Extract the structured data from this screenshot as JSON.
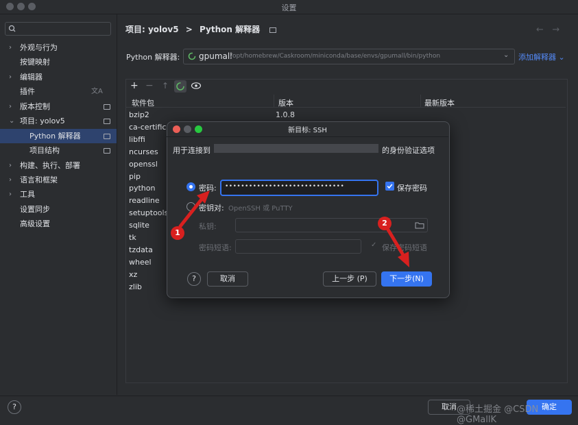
{
  "window": {
    "title": "设置"
  },
  "colors": {
    "accent": "#3574f0",
    "link": "#548af7",
    "annotation": "#d8201f",
    "selection": "#2e436e"
  },
  "sidebar": {
    "items": [
      {
        "label": "外观与行为",
        "chevron": true,
        "badge": false
      },
      {
        "label": "按键映射",
        "chevron": false,
        "badge": false
      },
      {
        "label": "编辑器",
        "chevron": true,
        "badge": false
      },
      {
        "label": "插件",
        "chevron": false,
        "badge": false,
        "icon": "translate-icon"
      },
      {
        "label": "版本控制",
        "chevron": true,
        "badge": true
      },
      {
        "label": "项目: yolov5",
        "chevron": true,
        "expanded": true,
        "badge": true
      },
      {
        "label": "Python 解释器",
        "chevron": false,
        "badge": true,
        "selected": true
      },
      {
        "label": "项目结构",
        "chevron": false,
        "badge": true
      },
      {
        "label": "构建、执行、部署",
        "chevron": true,
        "badge": false
      },
      {
        "label": "语言和框架",
        "chevron": true,
        "badge": false
      },
      {
        "label": "工具",
        "chevron": true,
        "badge": false
      },
      {
        "label": "设置同步",
        "chevron": false,
        "badge": false
      },
      {
        "label": "高级设置",
        "chevron": false,
        "badge": false
      }
    ]
  },
  "header": {
    "project": "项目: yolov5",
    "separator": ">",
    "page": "Python 解释器"
  },
  "interpreter": {
    "label": "Python 解释器:",
    "name": "gpumall",
    "path": "/opt/homebrew/Caskroom/miniconda/base/envs/gpumall/bin/python",
    "add_label": "添加解释器"
  },
  "packages": {
    "columns": [
      "软件包",
      "版本",
      "最新版本"
    ],
    "rows": [
      {
        "name": "bzip2",
        "version": "1.0.8"
      },
      {
        "name": "ca-certific",
        "version": ""
      },
      {
        "name": "libffi",
        "version": ""
      },
      {
        "name": "ncurses",
        "version": ""
      },
      {
        "name": "openssl",
        "version": ""
      },
      {
        "name": "pip",
        "version": ""
      },
      {
        "name": "python",
        "version": ""
      },
      {
        "name": "readline",
        "version": ""
      },
      {
        "name": "setuptools",
        "version": ""
      },
      {
        "name": "sqlite",
        "version": ""
      },
      {
        "name": "tk",
        "version": ""
      },
      {
        "name": "tzdata",
        "version": ""
      },
      {
        "name": "wheel",
        "version": ""
      },
      {
        "name": "xz",
        "version": ""
      },
      {
        "name": "zlib",
        "version": ""
      }
    ]
  },
  "dialog": {
    "title": "新目标: SSH",
    "desc_prefix": "用于连接到",
    "desc_suffix": "的身份验证选项",
    "password_label": "密码:",
    "password_value": "••••••••••••••••••••••••••••••",
    "save_password": "保存密码",
    "keypair_label": "密钥对:",
    "keypair_hint": "OpenSSH 或 PuTTY",
    "private_key_label": "私钥:",
    "passphrase_label": "密码短语:",
    "save_passphrase": "保存密码短语",
    "cancel": "取消",
    "prev": "上一步 (P)",
    "next": "下一步(N)",
    "help": "?"
  },
  "markers": [
    "1",
    "2"
  ],
  "bottom": {
    "cancel": "取消",
    "ok": "确定",
    "help": "?"
  },
  "watermark": "@稀土掘金  @CSDN @GMallK"
}
